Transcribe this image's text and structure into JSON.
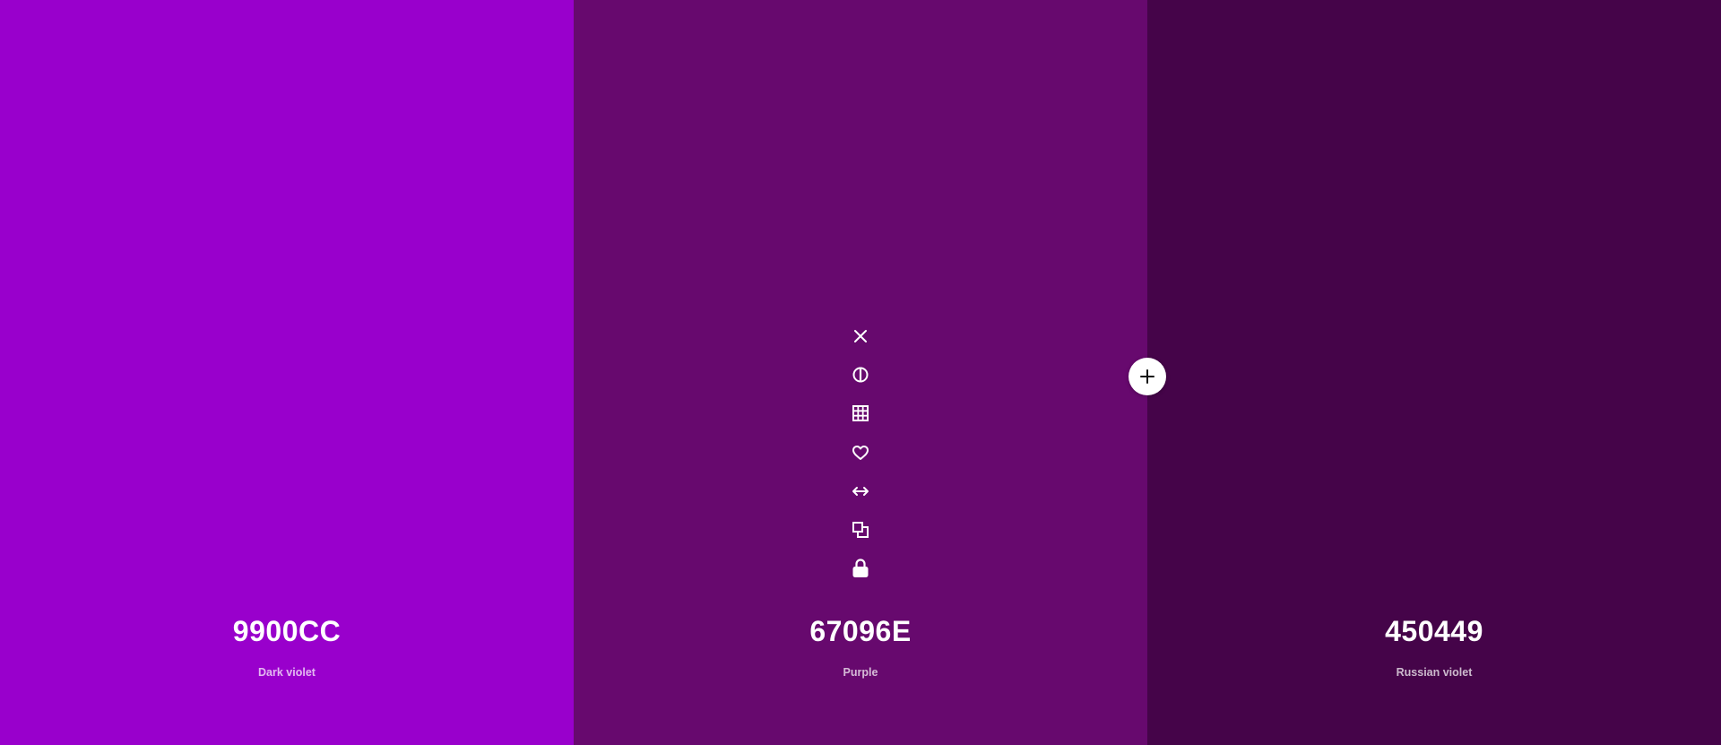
{
  "swatches": [
    {
      "hex": "9900CC",
      "name": "Dark violet",
      "color": "#9900cc"
    },
    {
      "hex": "67096E",
      "name": "Purple",
      "color": "#67096e"
    },
    {
      "hex": "450449",
      "name": "Russian violet",
      "color": "#450449"
    }
  ],
  "toolbar_icons": [
    "close-icon",
    "contrast-icon",
    "grid-icon",
    "heart-icon",
    "arrows-horizontal-icon",
    "copy-icon",
    "lock-icon"
  ],
  "add_button_icon": "plus-icon"
}
